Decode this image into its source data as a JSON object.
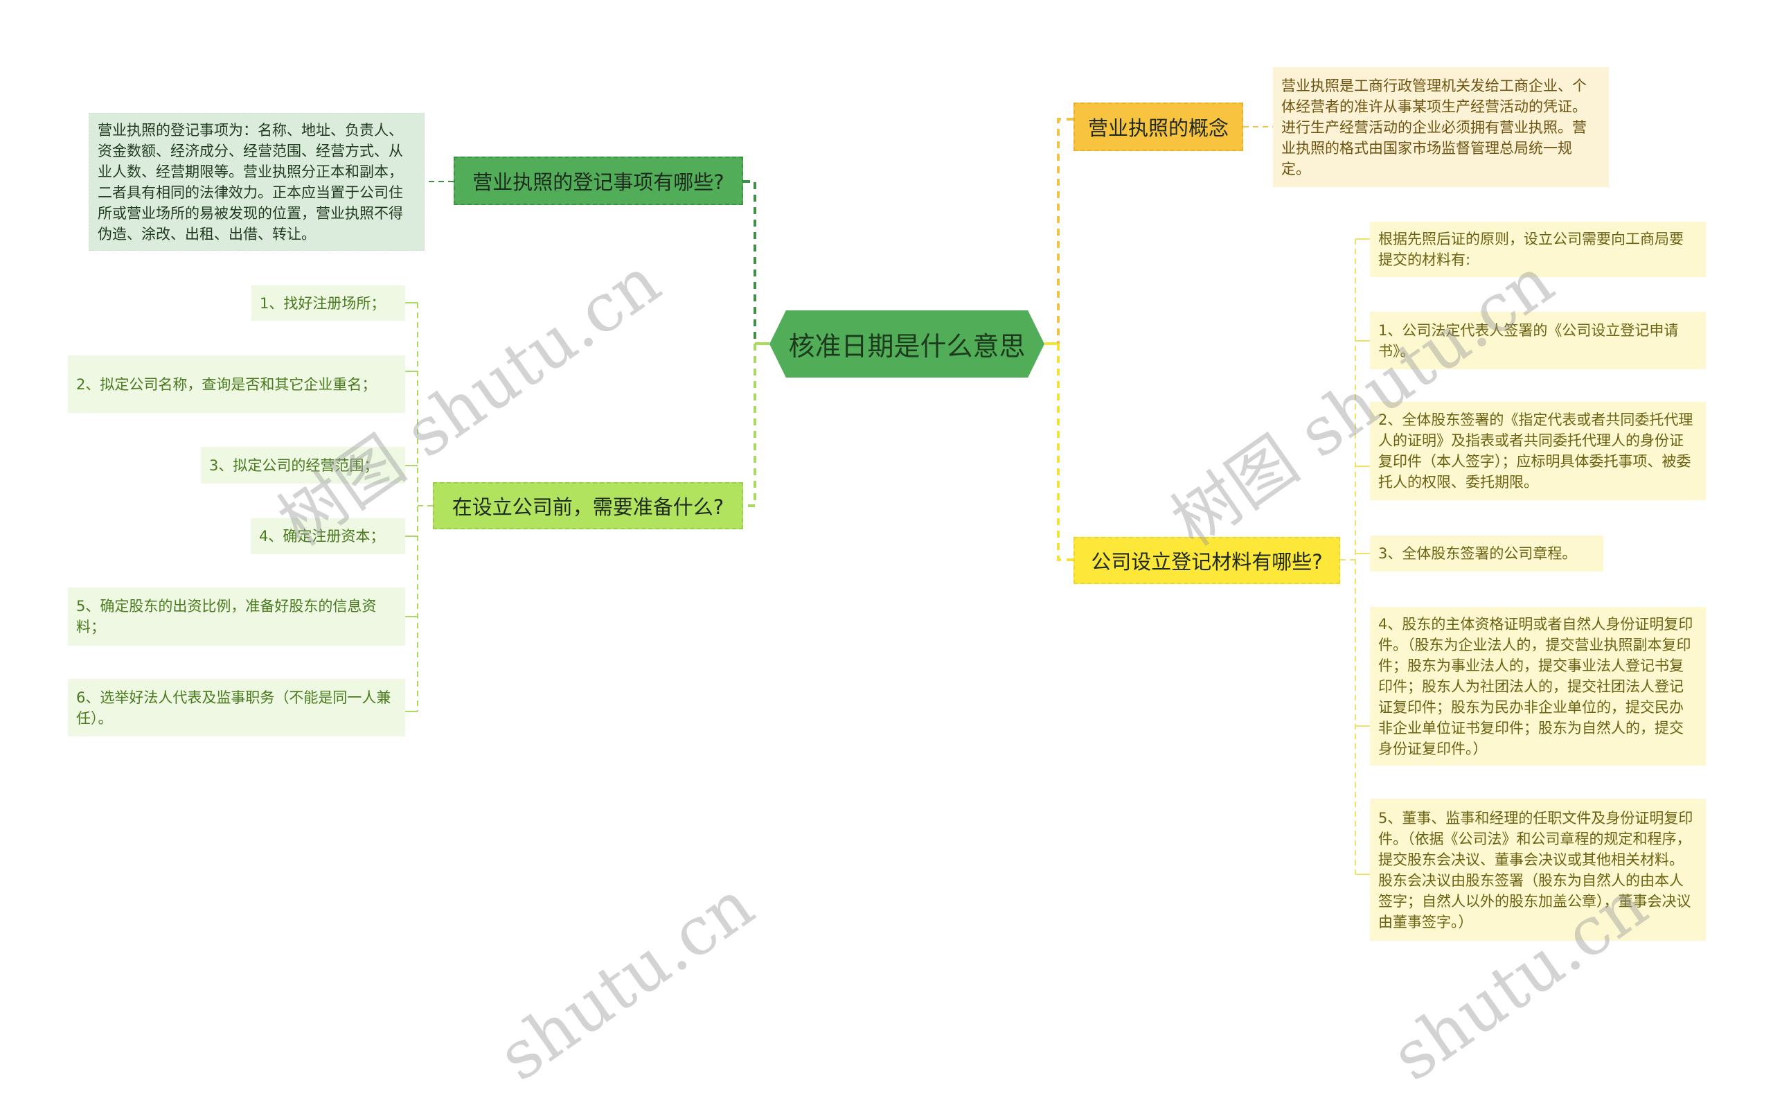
{
  "central_topic": "核准日期是什么意思",
  "colors": {
    "central": "#52ad59",
    "branch_registration": "#52ad59",
    "branch_prepare": "#b1e35f",
    "branch_concept": "#f8c33f",
    "branch_materials": "#fde83a"
  },
  "left_branches": [
    {
      "title": "营业执照的登记事项有哪些?",
      "children": [
        "营业执照的登记事项为：名称、地址、负责人、资金数额、经济成分、经营范围、经营方式、从业人数、经营期限等。营业执照分正本和副本，二者具有相同的法律效力。正本应当置于公司住所或营业场所的易被发现的位置，营业执照不得伪造、涂改、出租、出借、转让。"
      ]
    },
    {
      "title": "在设立公司前，需要准备什么?",
      "children": [
        "1、找好注册场所；",
        "2、拟定公司名称，查询是否和其它企业重名；",
        "3、拟定公司的经营范围；",
        "4、确定注册资本；",
        "5、确定股东的出资比例，准备好股东的信息资料；",
        "6、选举好法人代表及监事职务（不能是同一人兼任）。"
      ]
    }
  ],
  "right_branches": [
    {
      "title": "营业执照的概念",
      "children": [
        "营业执照是工商行政管理机关发给工商企业、个体经营者的准许从事某项生产经营活动的凭证。进行生产经营活动的企业必须拥有营业执照。营业执照的格式由国家市场监督管理总局统一规定。"
      ]
    },
    {
      "title": "公司设立登记材料有哪些?",
      "children": [
        "根据先照后证的原则，设立公司需要向工商局要提交的材料有:",
        "1、公司法定代表人签署的《公司设立登记申请书》。",
        "2、全体股东签署的《指定代表或者共同委托代理人的证明》及指表或者共同委托代理人的身份证复印件（本人签字）；应标明具体委托事项、被委托人的权限、委托期限。",
        "3、全体股东签署的公司章程。",
        "4、股东的主体资格证明或者自然人身份证明复印件。（股东为企业法人的，提交营业执照副本复印件；股东为事业法人的，提交事业法人登记书复印件；股东人为社团法人的，提交社团法人登记证复印件；股东为民办非企业单位的，提交民办非企业单位证书复印件；股东为自然人的，提交身份证复印件。）",
        "5、董事、监事和经理的任职文件及身份证明复印件。（依据《公司法》和公司章程的规定和程序，提交股东会决议、董事会决议或其他相关材料。股东会决议由股东签署（股东为自然人的由本人签字；自然人以外的股东加盖公章），董事会决议由董事签字。）"
      ]
    }
  ],
  "watermarks": [
    "树图 shutu.cn",
    "树图 shutu.cn",
    "shutu.cn",
    "shutu.cn"
  ]
}
